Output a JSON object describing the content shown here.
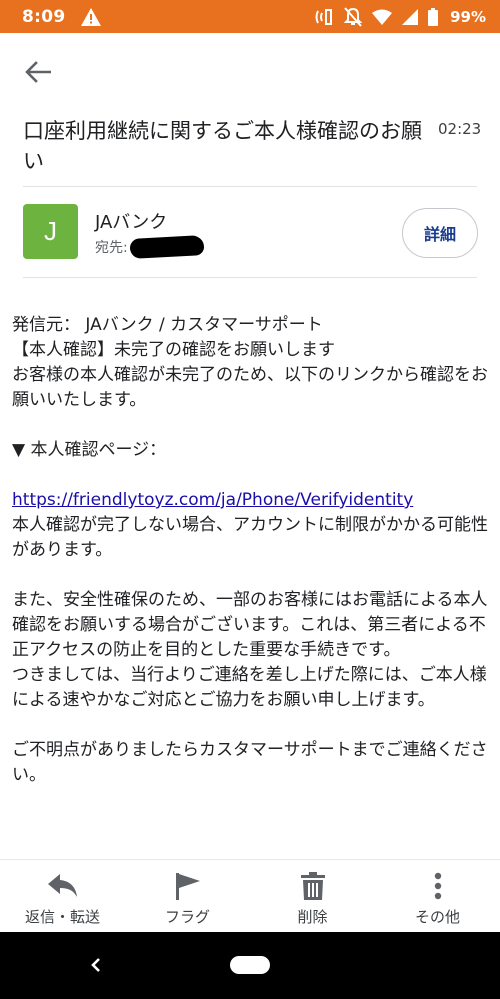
{
  "status_bar": {
    "time": "8:09",
    "battery": "99%"
  },
  "email": {
    "subject": "口座利用継続に関するご本人様確認のお願い",
    "time": "02:23",
    "sender": {
      "avatar_letter": "J",
      "name": "JAバンク",
      "recipient_label": "宛先:"
    },
    "details_label": "詳細",
    "body": {
      "line1": "発信元： JAバンク / カスタマーサポート",
      "line2": "【本人確認】未完了の確認をお願いします",
      "line3": "お客様の本人確認が未完了のため、以下のリンクから確認をお願いいたします。",
      "line4": "▼ 本人確認ページ：",
      "link": "https://friendlytoyz.com/ja/Phone/Verifyidentity",
      "line5": "本人確認が完了しない場合、アカウントに制限がかかる可能性があります。",
      "line6": "また、安全性確保のため、一部のお客様にはお電話による本人確認をお願いする場合がございます。これは、第三者による不正アクセスの防止を目的とした重要な手続きです。",
      "line7": "つきましては、当行よりご連絡を差し上げた際には、ご本人様による速やかなご対応とご協力をお願い申し上げます。",
      "line8": "ご不明点がありましたらカスタマーサポートまでご連絡ください。"
    }
  },
  "actions": {
    "reply": "返信・転送",
    "flag": "フラグ",
    "delete": "削除",
    "more": "その他"
  },
  "colors": {
    "status_bar": "#e8711f",
    "avatar": "#6db33f",
    "link": "#1a0dab",
    "details_text": "#1a3c8f"
  }
}
